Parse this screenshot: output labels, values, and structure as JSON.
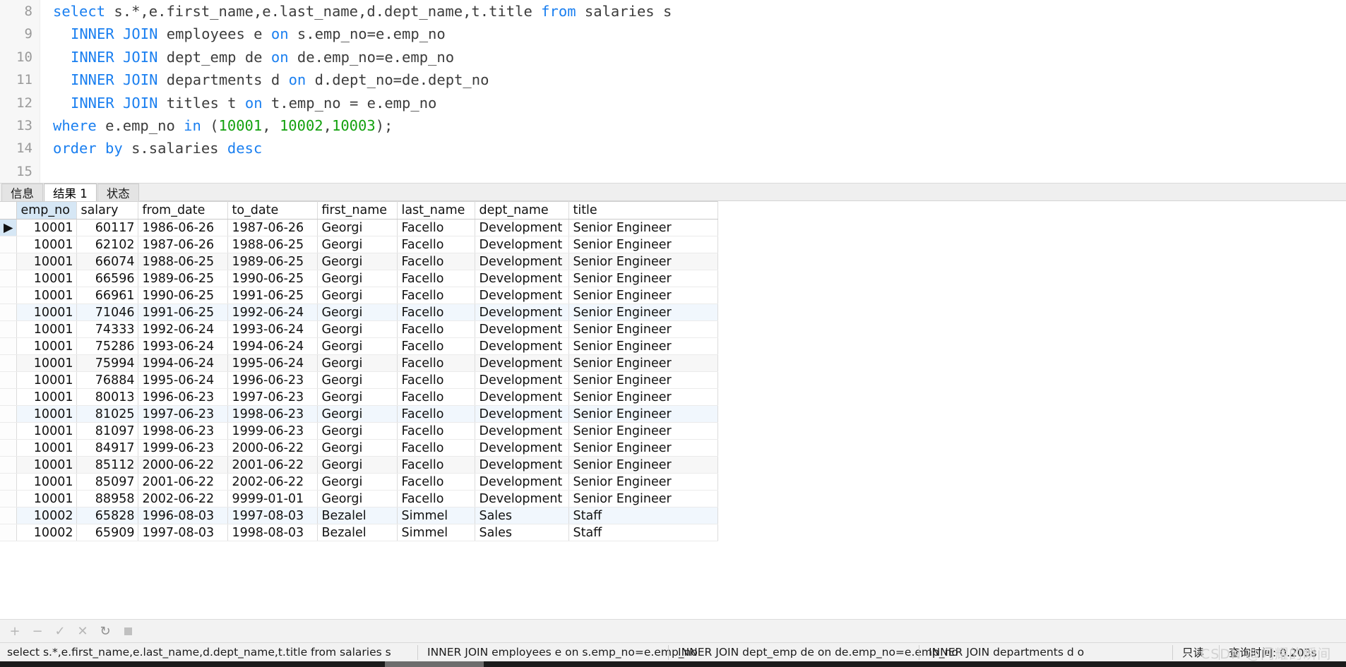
{
  "editor": {
    "lines": [
      {
        "no": "8",
        "indent": 0,
        "tokens": [
          {
            "t": "select ",
            "c": "kw"
          },
          {
            "t": "s.*,e.first_name,e.last_name,d.dept_name,t.title ",
            "c": "pl"
          },
          {
            "t": "from ",
            "c": "kw"
          },
          {
            "t": "salaries s",
            "c": "pl"
          }
        ]
      },
      {
        "no": "9",
        "indent": 1,
        "tokens": [
          {
            "t": "INNER JOIN ",
            "c": "kw"
          },
          {
            "t": "employees e ",
            "c": "pl"
          },
          {
            "t": "on ",
            "c": "kw"
          },
          {
            "t": "s.emp_no=e.emp_no",
            "c": "pl"
          }
        ]
      },
      {
        "no": "10",
        "indent": 1,
        "tokens": [
          {
            "t": "INNER JOIN ",
            "c": "kw"
          },
          {
            "t": "dept_emp de ",
            "c": "pl"
          },
          {
            "t": "on ",
            "c": "kw"
          },
          {
            "t": "de.emp_no=e.emp_no",
            "c": "pl"
          }
        ]
      },
      {
        "no": "11",
        "indent": 1,
        "tokens": [
          {
            "t": "INNER JOIN ",
            "c": "kw"
          },
          {
            "t": "departments d ",
            "c": "pl"
          },
          {
            "t": "on ",
            "c": "kw"
          },
          {
            "t": "d.dept_no=de.dept_no",
            "c": "pl"
          }
        ]
      },
      {
        "no": "12",
        "indent": 1,
        "tokens": [
          {
            "t": "INNER JOIN ",
            "c": "kw"
          },
          {
            "t": "titles t ",
            "c": "pl"
          },
          {
            "t": "on ",
            "c": "kw"
          },
          {
            "t": "t.emp_no = e.emp_no",
            "c": "pl"
          }
        ]
      },
      {
        "no": "13",
        "indent": 0,
        "tokens": [
          {
            "t": "where ",
            "c": "kw"
          },
          {
            "t": "e.emp_no ",
            "c": "pl"
          },
          {
            "t": "in ",
            "c": "kw"
          },
          {
            "t": "(",
            "c": "pl"
          },
          {
            "t": "10001",
            "c": "num"
          },
          {
            "t": ", ",
            "c": "pl"
          },
          {
            "t": "10002",
            "c": "num"
          },
          {
            "t": ",",
            "c": "pl"
          },
          {
            "t": "10003",
            "c": "num"
          },
          {
            "t": ");",
            "c": "pl"
          }
        ]
      },
      {
        "no": "14",
        "indent": 0,
        "tokens": [
          {
            "t": "order by ",
            "c": "kw"
          },
          {
            "t": "s.salaries ",
            "c": "pl"
          },
          {
            "t": "desc",
            "c": "kw"
          }
        ]
      },
      {
        "no": "15",
        "indent": 0,
        "tokens": []
      }
    ]
  },
  "tabs": [
    {
      "label": "信息",
      "active": false,
      "name": "tab-info"
    },
    {
      "label": "结果 1",
      "active": true,
      "name": "tab-result-1"
    },
    {
      "label": "状态",
      "active": false,
      "name": "tab-status"
    }
  ],
  "grid": {
    "columns": [
      "emp_no",
      "salary",
      "from_date",
      "to_date",
      "first_name",
      "last_name",
      "dept_name",
      "title"
    ],
    "selected_column": "emp_no",
    "current_row_index": 0,
    "rows": [
      [
        "10001",
        "60117",
        "1986-06-26",
        "1987-06-26",
        "Georgi",
        "Facello",
        "Development",
        "Senior Engineer"
      ],
      [
        "10001",
        "62102",
        "1987-06-26",
        "1988-06-25",
        "Georgi",
        "Facello",
        "Development",
        "Senior Engineer"
      ],
      [
        "10001",
        "66074",
        "1988-06-25",
        "1989-06-25",
        "Georgi",
        "Facello",
        "Development",
        "Senior Engineer"
      ],
      [
        "10001",
        "66596",
        "1989-06-25",
        "1990-06-25",
        "Georgi",
        "Facello",
        "Development",
        "Senior Engineer"
      ],
      [
        "10001",
        "66961",
        "1990-06-25",
        "1991-06-25",
        "Georgi",
        "Facello",
        "Development",
        "Senior Engineer"
      ],
      [
        "10001",
        "71046",
        "1991-06-25",
        "1992-06-24",
        "Georgi",
        "Facello",
        "Development",
        "Senior Engineer"
      ],
      [
        "10001",
        "74333",
        "1992-06-24",
        "1993-06-24",
        "Georgi",
        "Facello",
        "Development",
        "Senior Engineer"
      ],
      [
        "10001",
        "75286",
        "1993-06-24",
        "1994-06-24",
        "Georgi",
        "Facello",
        "Development",
        "Senior Engineer"
      ],
      [
        "10001",
        "75994",
        "1994-06-24",
        "1995-06-24",
        "Georgi",
        "Facello",
        "Development",
        "Senior Engineer"
      ],
      [
        "10001",
        "76884",
        "1995-06-24",
        "1996-06-23",
        "Georgi",
        "Facello",
        "Development",
        "Senior Engineer"
      ],
      [
        "10001",
        "80013",
        "1996-06-23",
        "1997-06-23",
        "Georgi",
        "Facello",
        "Development",
        "Senior Engineer"
      ],
      [
        "10001",
        "81025",
        "1997-06-23",
        "1998-06-23",
        "Georgi",
        "Facello",
        "Development",
        "Senior Engineer"
      ],
      [
        "10001",
        "81097",
        "1998-06-23",
        "1999-06-23",
        "Georgi",
        "Facello",
        "Development",
        "Senior Engineer"
      ],
      [
        "10001",
        "84917",
        "1999-06-23",
        "2000-06-22",
        "Georgi",
        "Facello",
        "Development",
        "Senior Engineer"
      ],
      [
        "10001",
        "85112",
        "2000-06-22",
        "2001-06-22",
        "Georgi",
        "Facello",
        "Development",
        "Senior Engineer"
      ],
      [
        "10001",
        "85097",
        "2001-06-22",
        "2002-06-22",
        "Georgi",
        "Facello",
        "Development",
        "Senior Engineer"
      ],
      [
        "10001",
        "88958",
        "2002-06-22",
        "9999-01-01",
        "Georgi",
        "Facello",
        "Development",
        "Senior Engineer"
      ],
      [
        "10002",
        "65828",
        "1996-08-03",
        "1997-08-03",
        "Bezalel",
        "Simmel",
        "Sales",
        "Staff"
      ],
      [
        "10002",
        "65909",
        "1997-08-03",
        "1998-08-03",
        "Bezalel",
        "Simmel",
        "Sales",
        "Staff"
      ]
    ]
  },
  "toolbar": {
    "buttons": [
      {
        "icon": "+",
        "name": "add-row-button"
      },
      {
        "icon": "−",
        "name": "delete-row-button"
      },
      {
        "icon": "✓",
        "name": "apply-changes-button"
      },
      {
        "icon": "✕",
        "name": "cancel-changes-button"
      },
      {
        "icon": "↻",
        "name": "refresh-button"
      },
      {
        "icon": "■",
        "name": "stop-button"
      }
    ]
  },
  "statusbar": {
    "segments": [
      "select s.*,e.first_name,e.last_name,d.dept_name,t.title from salaries s",
      "INNER JOIN employees e on s.emp_no=e.emp_no",
      "INNER JOIN dept_emp de on de.emp_no=e.emp_no",
      "INNER JOIN departments d o"
    ],
    "readonly_label": "只读",
    "query_time_label": "查询时间: 0.203s"
  },
  "watermark": {
    "text": "CSDN @闪耀的瞬间"
  },
  "colors": {
    "keyword": "#1a7ff0",
    "number": "#13a10e",
    "plain": "#3c3c3c",
    "gutter_bg": "#f7f7f7",
    "selected_header": "#d6e7f5",
    "row_alt_gray": "#f7f7f7",
    "row_alt_blue": "#f1f7fd"
  }
}
